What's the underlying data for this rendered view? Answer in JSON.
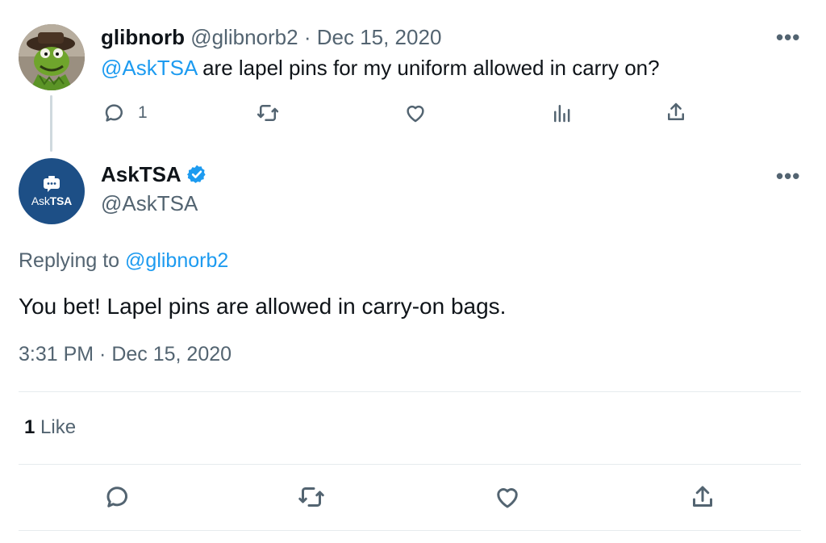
{
  "parent_tweet": {
    "display_name": "glibnorb",
    "handle": "@glibnorb2",
    "separator": "·",
    "date": "Dec 15, 2020",
    "mention": "@AskTSA",
    "text": " are lapel pins for my uniform allowed in carry on?",
    "more_label": "•••",
    "reply_count": "1",
    "avatar_icon": "kermit-avatar"
  },
  "main_tweet": {
    "display_name": "AskTSA",
    "handle": "@AskTSA",
    "more_label": "•••",
    "avatar_text_light": "Ask",
    "avatar_text_bold": "TSA",
    "verified_icon": "verified-badge-icon",
    "replying_prefix": "Replying to ",
    "replying_handle": "@glibnorb2",
    "text": "You bet! Lapel pins are allowed in carry-on bags.",
    "timestamp": "3:31 PM · Dec 15, 2020",
    "like_count": "1",
    "like_label": " Like"
  },
  "icons": {
    "reply": "reply-icon",
    "retweet": "retweet-icon",
    "like": "heart-icon",
    "views": "views-icon",
    "share": "share-icon"
  },
  "colors": {
    "accent": "#1d9bf0",
    "secondary_text": "#536471",
    "avatar_bg": "#1d4f86"
  }
}
